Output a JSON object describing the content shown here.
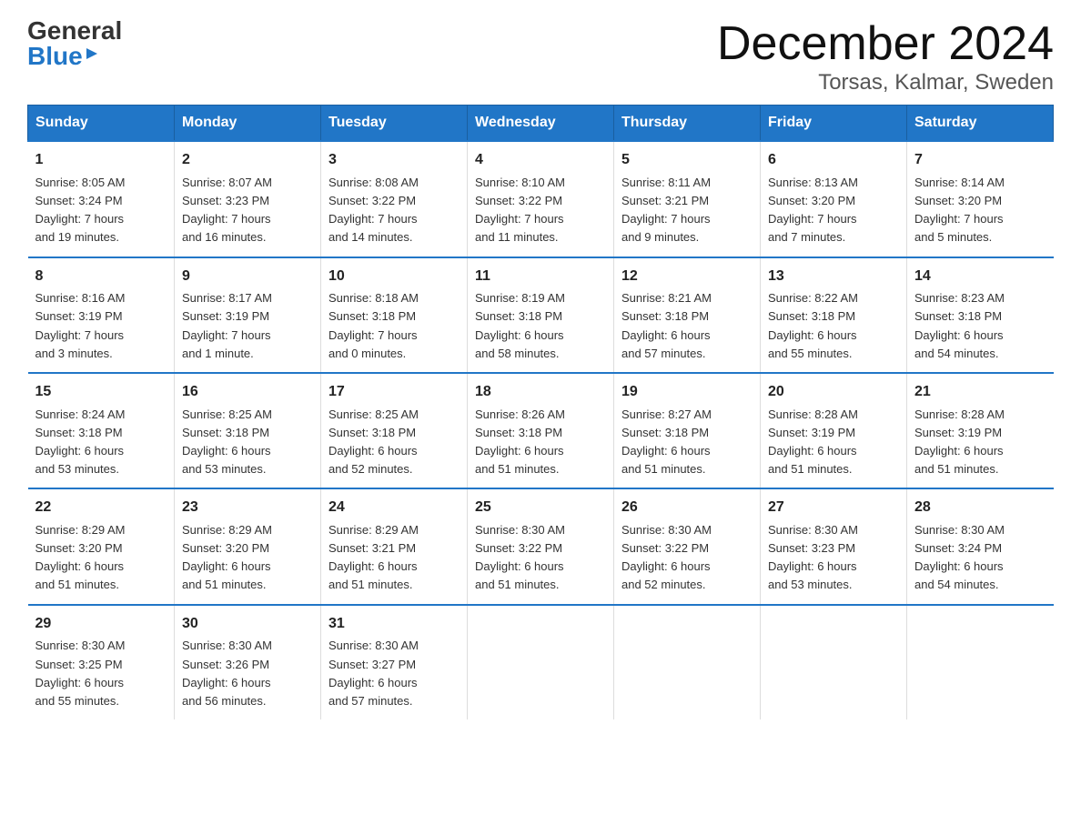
{
  "logo": {
    "general": "General",
    "blue": "Blue"
  },
  "title": {
    "month": "December 2024",
    "location": "Torsas, Kalmar, Sweden"
  },
  "weekdays": [
    "Sunday",
    "Monday",
    "Tuesday",
    "Wednesday",
    "Thursday",
    "Friday",
    "Saturday"
  ],
  "weeks": [
    [
      {
        "day": "1",
        "info": "Sunrise: 8:05 AM\nSunset: 3:24 PM\nDaylight: 7 hours\nand 19 minutes."
      },
      {
        "day": "2",
        "info": "Sunrise: 8:07 AM\nSunset: 3:23 PM\nDaylight: 7 hours\nand 16 minutes."
      },
      {
        "day": "3",
        "info": "Sunrise: 8:08 AM\nSunset: 3:22 PM\nDaylight: 7 hours\nand 14 minutes."
      },
      {
        "day": "4",
        "info": "Sunrise: 8:10 AM\nSunset: 3:22 PM\nDaylight: 7 hours\nand 11 minutes."
      },
      {
        "day": "5",
        "info": "Sunrise: 8:11 AM\nSunset: 3:21 PM\nDaylight: 7 hours\nand 9 minutes."
      },
      {
        "day": "6",
        "info": "Sunrise: 8:13 AM\nSunset: 3:20 PM\nDaylight: 7 hours\nand 7 minutes."
      },
      {
        "day": "7",
        "info": "Sunrise: 8:14 AM\nSunset: 3:20 PM\nDaylight: 7 hours\nand 5 minutes."
      }
    ],
    [
      {
        "day": "8",
        "info": "Sunrise: 8:16 AM\nSunset: 3:19 PM\nDaylight: 7 hours\nand 3 minutes."
      },
      {
        "day": "9",
        "info": "Sunrise: 8:17 AM\nSunset: 3:19 PM\nDaylight: 7 hours\nand 1 minute."
      },
      {
        "day": "10",
        "info": "Sunrise: 8:18 AM\nSunset: 3:18 PM\nDaylight: 7 hours\nand 0 minutes."
      },
      {
        "day": "11",
        "info": "Sunrise: 8:19 AM\nSunset: 3:18 PM\nDaylight: 6 hours\nand 58 minutes."
      },
      {
        "day": "12",
        "info": "Sunrise: 8:21 AM\nSunset: 3:18 PM\nDaylight: 6 hours\nand 57 minutes."
      },
      {
        "day": "13",
        "info": "Sunrise: 8:22 AM\nSunset: 3:18 PM\nDaylight: 6 hours\nand 55 minutes."
      },
      {
        "day": "14",
        "info": "Sunrise: 8:23 AM\nSunset: 3:18 PM\nDaylight: 6 hours\nand 54 minutes."
      }
    ],
    [
      {
        "day": "15",
        "info": "Sunrise: 8:24 AM\nSunset: 3:18 PM\nDaylight: 6 hours\nand 53 minutes."
      },
      {
        "day": "16",
        "info": "Sunrise: 8:25 AM\nSunset: 3:18 PM\nDaylight: 6 hours\nand 53 minutes."
      },
      {
        "day": "17",
        "info": "Sunrise: 8:25 AM\nSunset: 3:18 PM\nDaylight: 6 hours\nand 52 minutes."
      },
      {
        "day": "18",
        "info": "Sunrise: 8:26 AM\nSunset: 3:18 PM\nDaylight: 6 hours\nand 51 minutes."
      },
      {
        "day": "19",
        "info": "Sunrise: 8:27 AM\nSunset: 3:18 PM\nDaylight: 6 hours\nand 51 minutes."
      },
      {
        "day": "20",
        "info": "Sunrise: 8:28 AM\nSunset: 3:19 PM\nDaylight: 6 hours\nand 51 minutes."
      },
      {
        "day": "21",
        "info": "Sunrise: 8:28 AM\nSunset: 3:19 PM\nDaylight: 6 hours\nand 51 minutes."
      }
    ],
    [
      {
        "day": "22",
        "info": "Sunrise: 8:29 AM\nSunset: 3:20 PM\nDaylight: 6 hours\nand 51 minutes."
      },
      {
        "day": "23",
        "info": "Sunrise: 8:29 AM\nSunset: 3:20 PM\nDaylight: 6 hours\nand 51 minutes."
      },
      {
        "day": "24",
        "info": "Sunrise: 8:29 AM\nSunset: 3:21 PM\nDaylight: 6 hours\nand 51 minutes."
      },
      {
        "day": "25",
        "info": "Sunrise: 8:30 AM\nSunset: 3:22 PM\nDaylight: 6 hours\nand 51 minutes."
      },
      {
        "day": "26",
        "info": "Sunrise: 8:30 AM\nSunset: 3:22 PM\nDaylight: 6 hours\nand 52 minutes."
      },
      {
        "day": "27",
        "info": "Sunrise: 8:30 AM\nSunset: 3:23 PM\nDaylight: 6 hours\nand 53 minutes."
      },
      {
        "day": "28",
        "info": "Sunrise: 8:30 AM\nSunset: 3:24 PM\nDaylight: 6 hours\nand 54 minutes."
      }
    ],
    [
      {
        "day": "29",
        "info": "Sunrise: 8:30 AM\nSunset: 3:25 PM\nDaylight: 6 hours\nand 55 minutes."
      },
      {
        "day": "30",
        "info": "Sunrise: 8:30 AM\nSunset: 3:26 PM\nDaylight: 6 hours\nand 56 minutes."
      },
      {
        "day": "31",
        "info": "Sunrise: 8:30 AM\nSunset: 3:27 PM\nDaylight: 6 hours\nand 57 minutes."
      },
      {
        "day": "",
        "info": ""
      },
      {
        "day": "",
        "info": ""
      },
      {
        "day": "",
        "info": ""
      },
      {
        "day": "",
        "info": ""
      }
    ]
  ]
}
